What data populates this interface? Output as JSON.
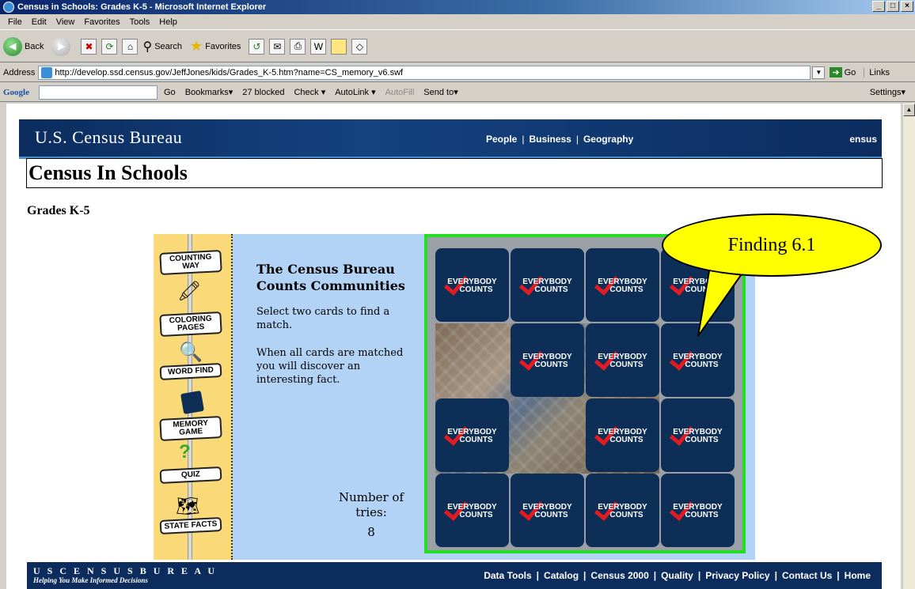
{
  "window": {
    "title": "Census in Schools: Grades K-5 - Microsoft Internet Explorer",
    "controls": [
      "_",
      "□",
      "×"
    ]
  },
  "menu": [
    "File",
    "Edit",
    "View",
    "Favorites",
    "Tools",
    "Help"
  ],
  "toolbar": {
    "back": "Back",
    "search": "Search",
    "favorites": "Favorites"
  },
  "address": {
    "label": "Address",
    "url": "http://develop.ssd.census.gov/JeffJones/kids/Grades_K-5.htm?name=CS_memory_v6.swf",
    "go": "Go",
    "links": "Links"
  },
  "googlebar": {
    "logo": "Google",
    "go": "Go",
    "bookmarks": "Bookmarks▾",
    "blocked": "27 blocked",
    "check": "Check ▾",
    "autolink": "AutoLink ▾",
    "autofill": "AutoFill",
    "sendto": "Send to▾",
    "settings": "Settings▾"
  },
  "site": {
    "logo": "U.S. Census Bureau",
    "nav": [
      "People",
      "Business",
      "Geography"
    ],
    "nav_right": "ensus",
    "page_title": "Census In Schools",
    "grades": "Grades K-5"
  },
  "game": {
    "menu": [
      "COUNTING WAY",
      "COLORING PAGES",
      "WORD FIND",
      "MEMORY GAME",
      "QUIZ",
      "STATE FACTS"
    ],
    "title": "The Census Bureau Counts Communities",
    "instructions1": "Select two cards to find a match.",
    "instructions2": "When all cards are matched you will discover an interesting fact.",
    "tries_label": "Number of tries:",
    "tries_value": "8",
    "card_line1": "EVERYBODY",
    "card_line2": "COUNTS"
  },
  "footer": {
    "logo": "U S C E N S U S B U R E A U",
    "tagline": "Helping You Make Informed Decisions",
    "links": [
      "Data Tools",
      "Catalog",
      "Census 2000",
      "Quality",
      "Privacy Policy",
      "Contact Us",
      "Home"
    ]
  },
  "callout": "Finding 6.1",
  "colors": {
    "census_navy": "#0c2c5e",
    "card_navy": "#0d2f57",
    "board_border": "#22dd22",
    "callout_yellow": "#ffff00"
  }
}
